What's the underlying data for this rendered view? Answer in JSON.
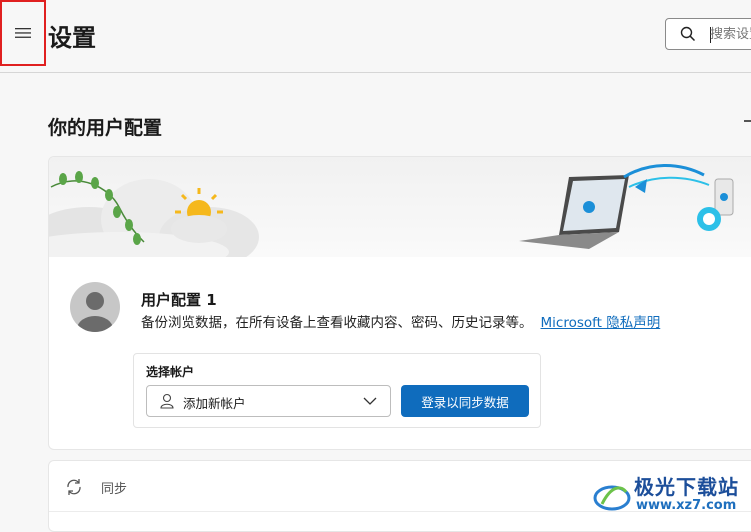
{
  "header": {
    "title": "设置",
    "search_placeholder": "搜索设置"
  },
  "profile_section": {
    "title": "你的用户配置",
    "profile_name": "用户配置 1",
    "description": "备份浏览数据，在所有设备上查看收藏内容、密码、历史记录等。",
    "privacy_link": "Microsoft 隐私声明",
    "account_label": "选择帐户",
    "account_select_value": "添加新帐户",
    "signin_button": "登录以同步数据"
  },
  "sync": {
    "label": "同步"
  },
  "watermark": {
    "text": "极光下载站",
    "url": "www.xz7.com"
  },
  "colors": {
    "accent": "#0f6cbd",
    "highlight": "#e02020"
  }
}
